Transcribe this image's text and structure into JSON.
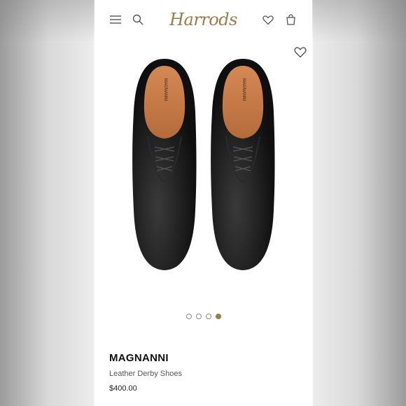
{
  "header": {
    "logo": "Harrods",
    "icons": [
      "menu-icon",
      "search-icon",
      "wishlist-icon",
      "bag-icon"
    ]
  },
  "product": {
    "brand": "MAGNANNI",
    "name": "Leather Derby Shoes",
    "price": "$400.00",
    "insole_text": "MAGNANNI",
    "image_count": 4,
    "active_image": 4
  },
  "colors": {
    "accent": "#9c7b4a",
    "leather": "#161616",
    "lining": "#c87a47"
  }
}
